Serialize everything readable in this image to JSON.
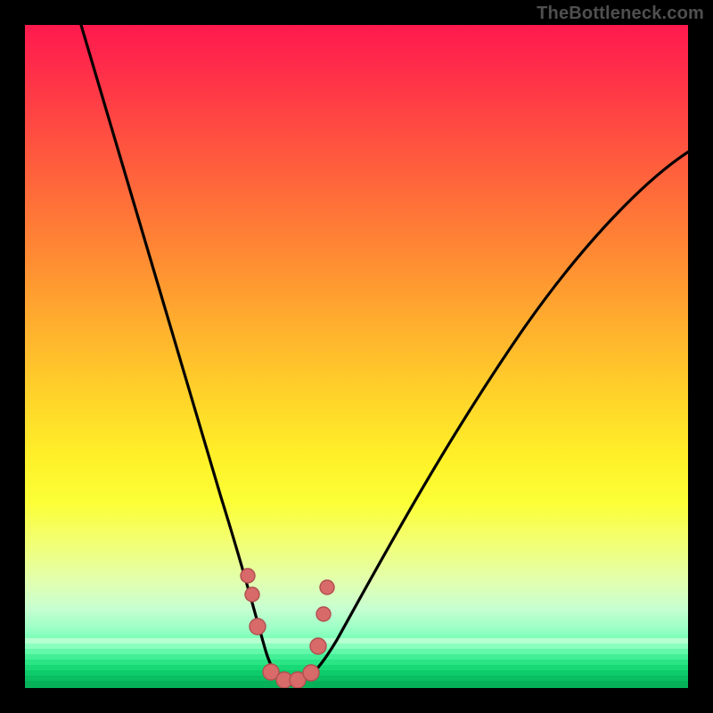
{
  "watermark": "TheBottleneck.com",
  "colors": {
    "frame_bg": "#000000",
    "gradient_top": "#ff1a4e",
    "gradient_mid": "#fff028",
    "gradient_bottom": "#07d062",
    "curve_stroke": "#000000",
    "marker_fill": "#d86a6a",
    "marker_stroke": "#b24f4f",
    "watermark_text": "#4f4f4f"
  },
  "chart_data": {
    "type": "line",
    "title": "",
    "xlabel": "",
    "ylabel": "",
    "xlim": [
      0,
      100
    ],
    "ylim": [
      0,
      100
    ],
    "grid": false,
    "legend": false,
    "notes": "V-shaped bottleneck curve over a red-to-green vertical gradient background. Two branches meet near the bottom center around x≈38. Salmon-colored markers sit on the valley of the curve near the bottom green band.",
    "series": [
      {
        "name": "left-branch",
        "x": [
          10,
          14,
          18,
          22,
          26,
          30,
          33,
          35,
          36.5,
          38,
          40
        ],
        "y": [
          100,
          85,
          70,
          56,
          43,
          31,
          20,
          12,
          6,
          2,
          0
        ]
      },
      {
        "name": "right-branch",
        "x": [
          40,
          43,
          46,
          50,
          56,
          63,
          71,
          80,
          90,
          100
        ],
        "y": [
          0,
          3,
          7,
          13,
          22,
          33,
          45,
          58,
          70,
          80
        ]
      }
    ],
    "markers": {
      "name": "bottleneck-points",
      "x": [
        33.5,
        34.2,
        35.0,
        37.0,
        39.0,
        41.0,
        43.0,
        44.2,
        45.0,
        45.5
      ],
      "y": [
        17,
        14,
        9,
        2,
        1,
        1,
        2,
        6,
        11,
        15
      ]
    }
  }
}
